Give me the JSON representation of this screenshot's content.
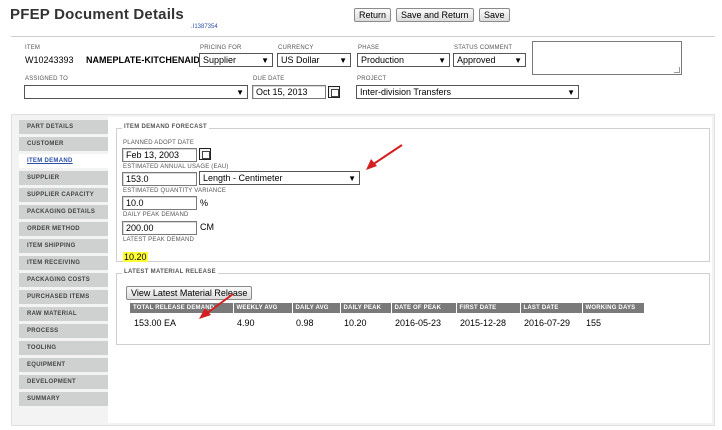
{
  "page": {
    "title": "PFEP Document Details",
    "doc_number": ".I1387354"
  },
  "toolbar": {
    "return_label": "Return",
    "save_return_label": "Save and Return",
    "save_label": "Save"
  },
  "header": {
    "item_label": "ITEM",
    "item_number": "W10243393",
    "item_name": "NAMEPLATE-KITCHENAID",
    "pricing_for_label": "PRICING FOR",
    "pricing_for_value": "Supplier",
    "currency_label": "CURRENCY",
    "currency_value": "US Dollar",
    "phase_label": "PHASE",
    "phase_value": "Production",
    "status_label": "STATUS COMMENT",
    "status_value": "Approved",
    "assigned_to_label": "ASSIGNED TO",
    "assigned_to_value": "",
    "due_date_label": "DUE DATE",
    "due_date_value": "Oct 15, 2013",
    "project_label": "PROJECT",
    "project_value": "Inter-division Transfers"
  },
  "sidebar": {
    "items": [
      {
        "label": "PART DETAILS"
      },
      {
        "label": "CUSTOMER"
      },
      {
        "label": "ITEM DEMAND"
      },
      {
        "label": "SUPPLIER"
      },
      {
        "label": "SUPPLIER CAPACITY"
      },
      {
        "label": "PACKAGING DETAILS"
      },
      {
        "label": "ORDER METHOD"
      },
      {
        "label": "ITEM SHIPPING"
      },
      {
        "label": "ITEM RECEIVING"
      },
      {
        "label": "PACKAGING COSTS"
      },
      {
        "label": "PURCHASED ITEMS"
      },
      {
        "label": "RAW MATERIAL"
      },
      {
        "label": "PROCESS"
      },
      {
        "label": "TOOLING"
      },
      {
        "label": "EQUIPMENT"
      },
      {
        "label": "DEVELOPMENT"
      },
      {
        "label": "SUMMARY"
      }
    ],
    "active_label": "ITEM DEMAND"
  },
  "forecast": {
    "legend": "ITEM DEMAND FORECAST",
    "adopt_date_label": "PLANNED ADOPT DATE",
    "adopt_date_value": "Feb 13, 2003",
    "eau_label": "ESTIMATED ANNUAL USAGE (EAU)",
    "eau_value": "153.0",
    "eau_unit": "Length - Centimeter",
    "variance_label": "ESTIMATED QUANTITY VARIANCE",
    "variance_value": "10.0",
    "variance_unit": "%",
    "daily_peak_label": "DAILY PEAK DEMAND",
    "daily_peak_value": "200.00",
    "daily_peak_unit": "CM",
    "latest_peak_label": "LATEST PEAK DEMAND",
    "latest_peak_value": "10.20"
  },
  "release": {
    "legend": "LATEST MATERIAL RELEASE",
    "view_button": "View Latest Material Release",
    "columns": [
      "TOTAL RELEASE DEMAND",
      "WEEKLY AVG",
      "DAILY AVG",
      "DAILY PEAK",
      "DATE OF PEAK",
      "FIRST DATE",
      "LAST DATE",
      "WORKING DAYS"
    ],
    "row": [
      "153.00 EA",
      "4.90",
      "0.98",
      "10.20",
      "2016-05-23",
      "2015-12-28",
      "2016-07-29",
      "155"
    ]
  },
  "colors": {
    "highlight": "#ffff33",
    "annotation_arrow": "#d42020",
    "nav_bg": "#cfd0d0",
    "table_header": "#7a7a7a"
  }
}
